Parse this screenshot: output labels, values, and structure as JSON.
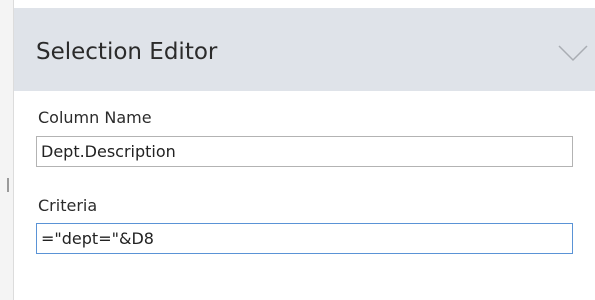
{
  "panel": {
    "title": "Selection Editor",
    "collapse_icon": "chevron-down-icon"
  },
  "fields": {
    "column_name": {
      "label": "Column Name",
      "value": "Dept.Description"
    },
    "criteria": {
      "label": "Criteria",
      "value": "=\"dept=\"&D8"
    }
  },
  "colors": {
    "header_background": "#dfe3e9",
    "focused_border": "#5a93d6",
    "input_border": "#b3b3b3"
  }
}
